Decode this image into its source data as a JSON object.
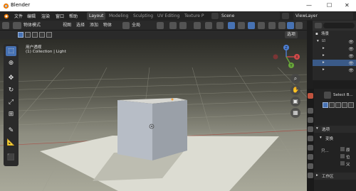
{
  "window": {
    "title": "Blender",
    "minimize": "—",
    "maximize": "☐",
    "close": "✕"
  },
  "topbar": {
    "menus": [
      "文件",
      "编辑",
      "渲染",
      "窗口",
      "帮助"
    ],
    "workspaces": [
      "Layout",
      "Modeling",
      "Sculpting",
      "UV Editing",
      "Texture P"
    ],
    "active_workspace": "Layout",
    "scene": "Scene",
    "view_layer": "ViewLayer"
  },
  "viewport_header": {
    "mode": "物体模式",
    "menus": [
      "视图",
      "选择",
      "添加",
      "物体"
    ],
    "transform_orientation": "全局"
  },
  "viewport_row2": {
    "options_label": "选项"
  },
  "viewport": {
    "view_name": "用户透视",
    "collection_info": "(1) Collection | Light"
  },
  "gizmo": {
    "x": "X",
    "y": "Y",
    "z": "Z"
  },
  "outliner": {
    "header": "场景"
  },
  "properties": {
    "select_label": "Select B...",
    "options_section": "选项",
    "transform_section": "变换",
    "affect_label": "只...",
    "affect_options": [
      "原",
      "位",
      "父"
    ],
    "workspace_section": "工作区"
  }
}
